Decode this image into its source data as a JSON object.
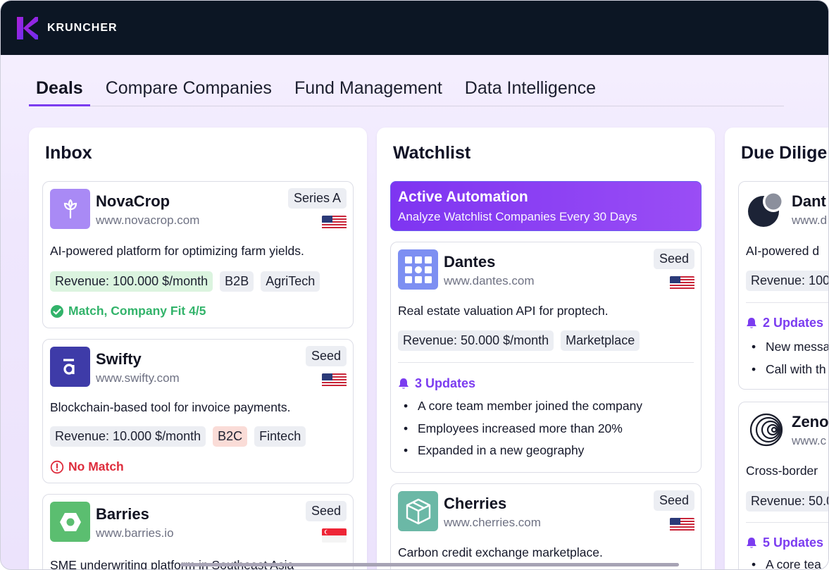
{
  "app": {
    "brand": "KRUNCHER",
    "accent": "#7b3cf0",
    "topbar_color": "#0c1624"
  },
  "tabs": [
    {
      "label": "Deals",
      "active": true
    },
    {
      "label": "Compare Companies",
      "active": false
    },
    {
      "label": "Fund Management",
      "active": false
    },
    {
      "label": "Data Intelligence",
      "active": false
    }
  ],
  "columns": {
    "inbox": {
      "title": "Inbox",
      "cards": [
        {
          "name": "NovaCrop",
          "url": "www.novacrop.com",
          "stage": "Series A",
          "flag": "us",
          "logo_icon": "sprout-icon",
          "logo_color": "#a98af5",
          "description": "AI-powered platform for optimizing farm yields.",
          "tags": [
            {
              "label": "Revenue: 100.000 $/month",
              "style": "green"
            },
            {
              "label": "B2B",
              "style": "gray"
            },
            {
              "label": "AgriTech",
              "style": "gray"
            }
          ],
          "status": {
            "icon": "check-circle-icon",
            "label": "Match, Company Fit 4/5",
            "kind": "good"
          }
        },
        {
          "name": "Swifty",
          "url": "www.swifty.com",
          "stage": "Seed",
          "flag": "us",
          "logo_icon": "swifty-logo-icon",
          "logo_color": "#3e3ba8",
          "description": "Blockchain-based tool for invoice payments.",
          "tags": [
            {
              "label": "Revenue: 10.000 $/month",
              "style": "gray"
            },
            {
              "label": "B2C",
              "style": "red"
            },
            {
              "label": "Fintech",
              "style": "gray"
            }
          ],
          "status": {
            "icon": "alert-circle-icon",
            "label": "No Match",
            "kind": "bad"
          }
        },
        {
          "name": "Barries",
          "url": "www.barries.io",
          "stage": "Seed",
          "flag": "sg",
          "logo_icon": "hexagon-icon",
          "logo_color": "#5bbe70",
          "description": "SME underwriting platform in Southeast Asia"
        }
      ]
    },
    "watchlist": {
      "title": "Watchlist",
      "automation": {
        "title": "Active Automation",
        "subtitle": "Analyze Watchlist Companies Every 30 Days"
      },
      "cards": [
        {
          "name": "Dantes",
          "url": "www.dantes.com",
          "stage": "Seed",
          "flag": "us",
          "logo_icon": "grid-dots-icon",
          "logo_color": "#7d8ff2",
          "description": "Real estate valuation API for proptech.",
          "tags": [
            {
              "label": "Revenue: 50.000 $/month",
              "style": "gray"
            },
            {
              "label": "Marketplace",
              "style": "gray"
            }
          ],
          "updates_label": "3 Updates",
          "updates": [
            "A core team member joined the company",
            "Employees increased more than 20%",
            "Expanded in a new geography"
          ]
        },
        {
          "name": "Cherries",
          "url": "www.cherries.com",
          "stage": "Seed",
          "flag": "us",
          "logo_icon": "cube-icon",
          "logo_color": "#6bb8a6",
          "description": "Carbon credit exchange marketplace."
        }
      ]
    },
    "due_diligence": {
      "title": "Due Dilige",
      "cards": [
        {
          "name": "Dant",
          "url": "www.d",
          "logo_icon": "moon-circles-icon",
          "description": "AI-powered d",
          "tags": [
            {
              "label": "Revenue: 100",
              "style": "gray"
            }
          ],
          "updates_label": "2 Updates",
          "updates": [
            "New messa",
            "Call with th"
          ]
        },
        {
          "name": "Zeno",
          "url": "www.c",
          "logo_icon": "swirl-icon",
          "description": "Cross-border",
          "tags": [
            {
              "label": "Revenue: 50.0",
              "style": "gray"
            }
          ],
          "updates_label": "5 Updates",
          "updates": [
            "A core tea"
          ]
        }
      ]
    }
  }
}
